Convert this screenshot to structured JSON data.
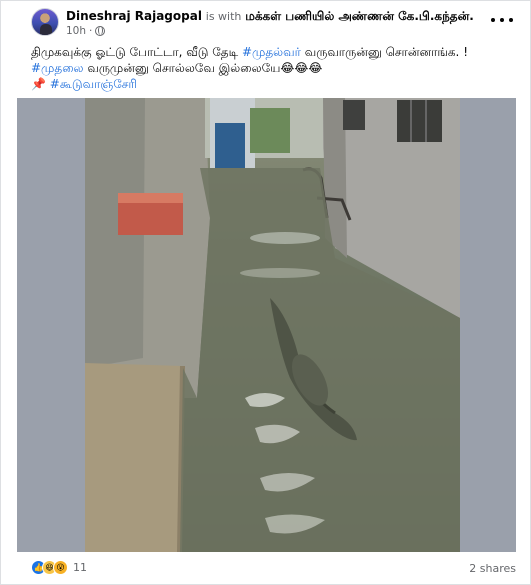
{
  "post": {
    "author": "Dineshraj Rajagopal",
    "with_text": "is with",
    "tagged": "மக்கள் பணியில் அண்ணன் கே.பி.கந்தன்.",
    "time": "10h",
    "privacy_icon": "globe-icon",
    "more_icon": "more-options-icon"
  },
  "caption": {
    "line1_text": "திமுகவுக்கு ஓட்டு போட்டா, வீடு தேடி ",
    "line1_hashtag": "#முதல்வர்",
    "line1_rest": " வருவாருன்னு சொன்னாங்க. !",
    "line2_hashtag": "#முதலை",
    "line2_rest": " வருமுன்னு சொல்லவே இல்லையே😂😂😂",
    "line3_pin": "📌",
    "line3_hashtag": "#கூடுவாஞ்சேரி"
  },
  "reactions": {
    "icons": [
      "like-icon",
      "haha-icon",
      "wow-icon"
    ],
    "count": "11"
  },
  "shares": "2 shares",
  "colors": {
    "hashtag": "#216fdb",
    "secondary_text": "#65676b",
    "like_blue": "#1b74e4"
  }
}
